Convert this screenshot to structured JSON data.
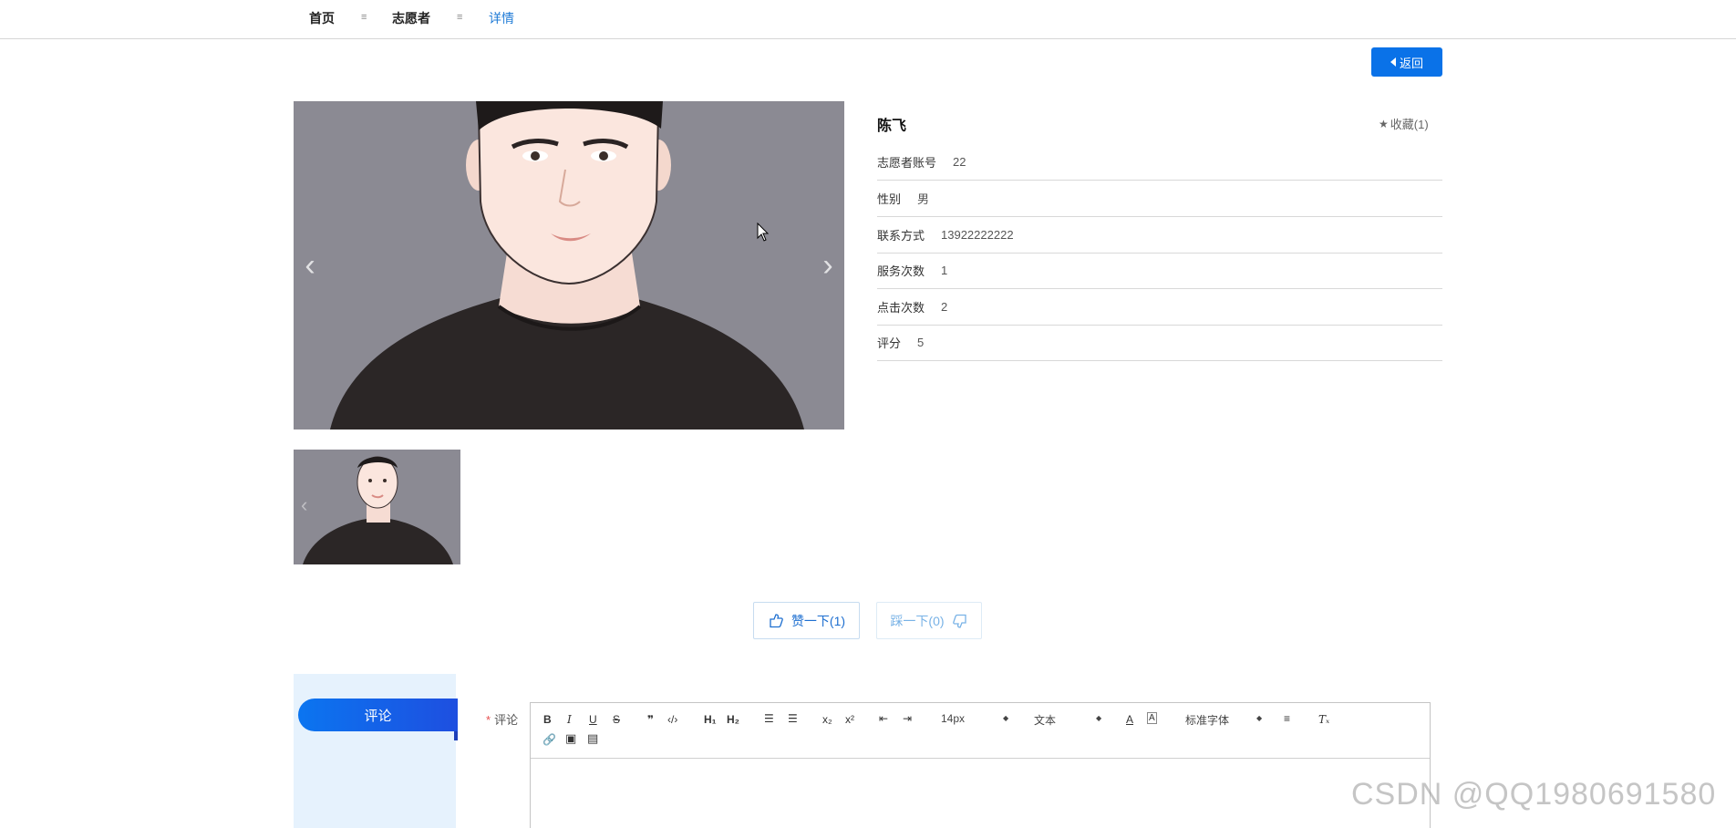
{
  "breadcrumb": {
    "items": [
      {
        "label": "首页"
      },
      {
        "label": "志愿者"
      },
      {
        "label": "详情"
      }
    ],
    "separator": "≡"
  },
  "back_button": {
    "label": "返回"
  },
  "profile": {
    "name": "陈飞",
    "favorite_label": "收藏(1)",
    "fields": [
      {
        "label": "志愿者账号",
        "value": "22"
      },
      {
        "label": "性别",
        "value": "男"
      },
      {
        "label": "联系方式",
        "value": "13922222222"
      },
      {
        "label": "服务次数",
        "value": "1"
      },
      {
        "label": "点击次数",
        "value": "2"
      },
      {
        "label": "评分",
        "value": "5"
      }
    ]
  },
  "votes": {
    "like_label": "赞一下(1)",
    "dislike_label": "踩一下(0)"
  },
  "comment": {
    "tab_label": "评论",
    "field_label": "评论",
    "required_mark": "*",
    "toolbar": {
      "font_size": "14px",
      "header": "文本",
      "font_family": "标准字体"
    }
  },
  "watermark": "CSDN @QQ1980691580",
  "colors": {
    "primary": "#0a72e8",
    "link": "#1e7ad6",
    "photo_bg": "#8b8a93",
    "comment_side_bg": "#e6f2fd"
  },
  "icons": {
    "favorite": "star-icon",
    "like": "thumbs-up-icon",
    "dislike": "thumbs-down-icon",
    "back": "caret-left-icon"
  }
}
